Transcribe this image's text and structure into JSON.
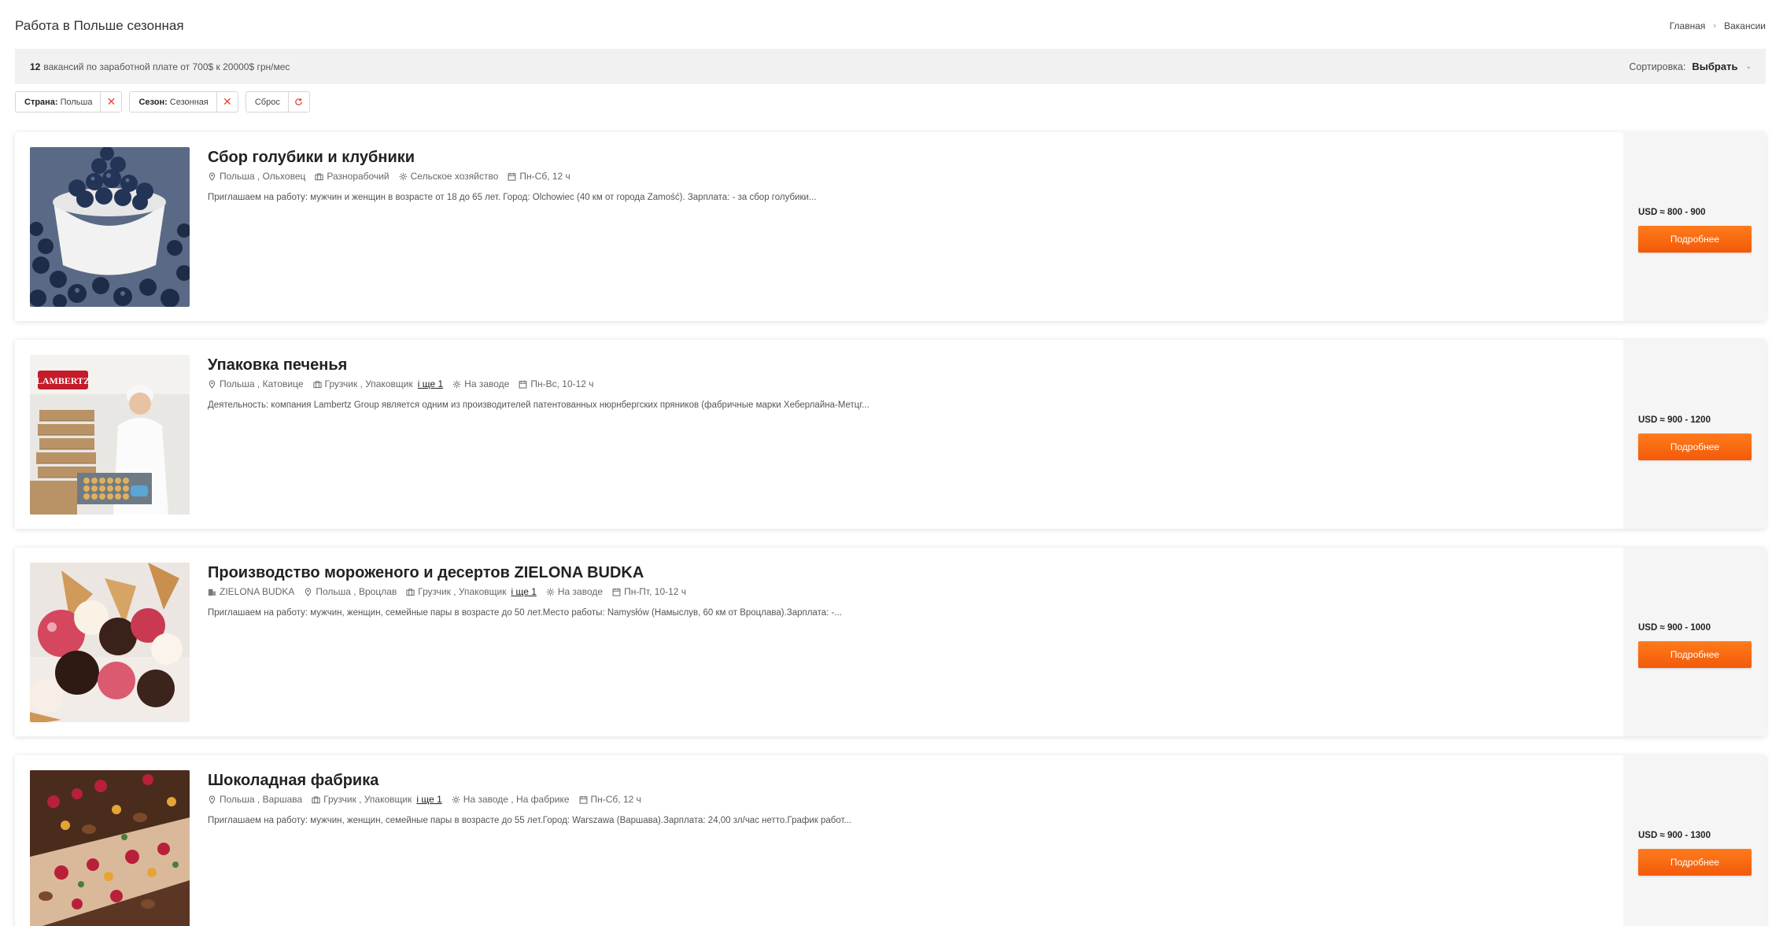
{
  "header": {
    "title": "Работа в Польше сезонная",
    "breadcrumb": {
      "home": "Главная",
      "sep": "›",
      "current": "Вакансии"
    }
  },
  "summary": {
    "count": "12",
    "text": "вакансий по заработной плате от 700$ к 20000$ грн/мес",
    "sort_label": "Сортировка:",
    "sort_value": "Выбрать"
  },
  "filters": [
    {
      "key": "Страна:",
      "value": "Польша",
      "icon": "close-icon"
    },
    {
      "key": "Сезон:",
      "value": "Сезонная",
      "icon": "close-icon"
    },
    {
      "key": "",
      "value": "Сброс",
      "icon": "reset-icon"
    }
  ],
  "colors": {
    "accent": "#f25a0a",
    "remove": "#e4473a"
  },
  "vacancies": [
    {
      "title": "Сбор голубики и клубники",
      "company": "",
      "location": "Польша , Ольховец",
      "profession": "Разнорабочий",
      "more": "",
      "sector": "Сельское хозяйство",
      "schedule": "Пн-Сб, 12 ч",
      "description": "Приглашаем на работу: мужчин и женщин в возрасте от 18 до 65 лет. Город: Olchowiec (40 км от города Zamość). Зарплата: - за сбор голубики...",
      "salary": "USD ≈ 800 - 900",
      "button": "Подробнее",
      "image": "blueberries-photo"
    },
    {
      "title": "Упаковка печенья",
      "company": "",
      "location": "Польша , Катовице",
      "profession": "Грузчик , Упаковщик",
      "more": "і ще 1",
      "sector": "На заводе",
      "schedule": "Пн-Вс, 10-12 ч",
      "description": "Деятельность: компания Lambertz Group является одним из производителей патентованных нюрнбергских пряников (фабричные марки Хеберлайна-Метцг...",
      "salary": "USD ≈ 900 - 1200",
      "button": "Подробнее",
      "image": "lambertz-factory-photo",
      "logo_text": "LAMBERTZ"
    },
    {
      "title": "Производство мороженого и десертов ZIELONA BUDKA",
      "company": "ZIELONA BUDKA",
      "location": "Польша , Вроцлав",
      "profession": "Грузчик , Упаковщик",
      "more": "і ще 1",
      "sector": "На заводе",
      "schedule": "Пн-Пт, 10-12 ч",
      "description": "Приглашаем на работу: мужчин, женщин, семейные пары в возрасте до 50 лет.Место работы: Namysłów (Намыслув, 60 км от Вроцлава).Зарплата: -...",
      "salary": "USD ≈ 900 - 1000",
      "button": "Подробнее",
      "image": "ice-cream-cones-photo"
    },
    {
      "title": "Шоколадная фабрика",
      "company": "",
      "location": "Польша , Варшава",
      "profession": "Грузчик , Упаковщик",
      "more": "і ще 1",
      "sector": "На заводе , На фабрике",
      "schedule": "Пн-Сб, 12 ч",
      "description": "Приглашаем на работу: мужчин, женщин, семейные пары в возрасте до 55 лет.Город: Warszawa (Варшава).Зарплата: 24,00 зл/час нетто.График работ...",
      "salary": "USD ≈ 900 - 1300",
      "button": "Подробнее",
      "image": "chocolate-bars-photo"
    }
  ]
}
